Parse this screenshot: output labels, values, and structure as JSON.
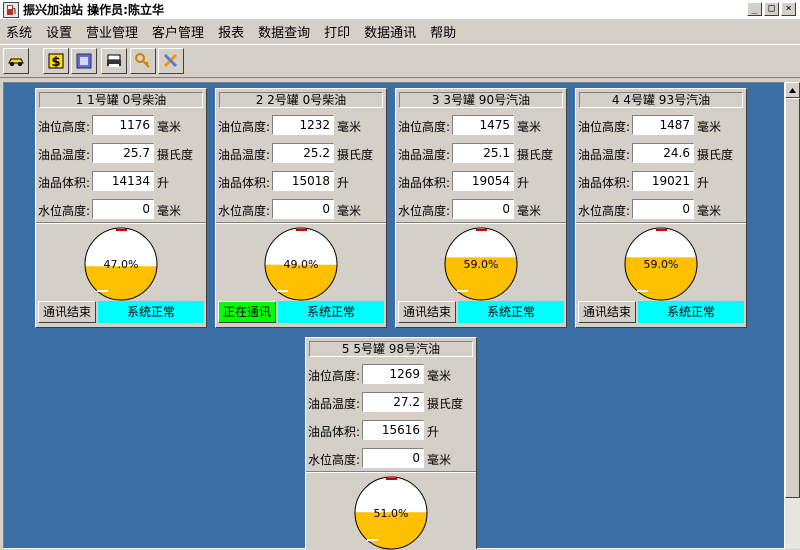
{
  "window": {
    "title": "振兴加油站   操作员:陈立华",
    "buttons": [
      "_",
      "□",
      "×"
    ]
  },
  "menu": [
    "系统",
    "设置",
    "营业管理",
    "客户管理",
    "报表",
    "数据查询",
    "打印",
    "数据通讯",
    "帮助"
  ],
  "toolbar": {
    "icons": [
      "car-icon",
      "money-icon",
      "database-icon",
      "printer-icon",
      "key-icon",
      "tools-icon"
    ]
  },
  "labels": {
    "oil_height": "油位高度:",
    "oil_temp": "油品温度:",
    "oil_volume": "油品体积:",
    "water_height": "水位高度:",
    "unit_mm": "毫米",
    "unit_celsius": "摄氏度",
    "unit_liter": "升"
  },
  "colors": {
    "background": "#3a6ea5",
    "fuel_fill": "#ffc000",
    "status_bg": "#00ffff",
    "comm_active": "#00ff00",
    "needle": "#cc0000"
  },
  "tanks": [
    {
      "title": "1   1号罐   0号柴油",
      "oil_height": "1176",
      "oil_temp": "25.7",
      "oil_volume": "14134",
      "water_height": "0",
      "fill_percent": 47.0,
      "fill_label": "47.0%",
      "comm_status": "通讯结束",
      "comm_active": false,
      "system_status": "系统正常"
    },
    {
      "title": "2   2号罐   0号柴油",
      "oil_height": "1232",
      "oil_temp": "25.2",
      "oil_volume": "15018",
      "water_height": "0",
      "fill_percent": 49.0,
      "fill_label": "49.0%",
      "comm_status": "正在通讯",
      "comm_active": true,
      "system_status": "系统正常"
    },
    {
      "title": "3   3号罐   90号汽油",
      "oil_height": "1475",
      "oil_temp": "25.1",
      "oil_volume": "19054",
      "water_height": "0",
      "fill_percent": 59.0,
      "fill_label": "59.0%",
      "comm_status": "通讯结束",
      "comm_active": false,
      "system_status": "系统正常"
    },
    {
      "title": "4   4号罐   93号汽油",
      "oil_height": "1487",
      "oil_temp": "24.6",
      "oil_volume": "19021",
      "water_height": "0",
      "fill_percent": 59.0,
      "fill_label": "59.0%",
      "comm_status": "通讯结束",
      "comm_active": false,
      "system_status": "系统正常"
    },
    {
      "title": "5   5号罐   98号汽油",
      "oil_height": "1269",
      "oil_temp": "27.2",
      "oil_volume": "15616",
      "water_height": "0",
      "fill_percent": 51.0,
      "fill_label": "51.0%"
    }
  ]
}
